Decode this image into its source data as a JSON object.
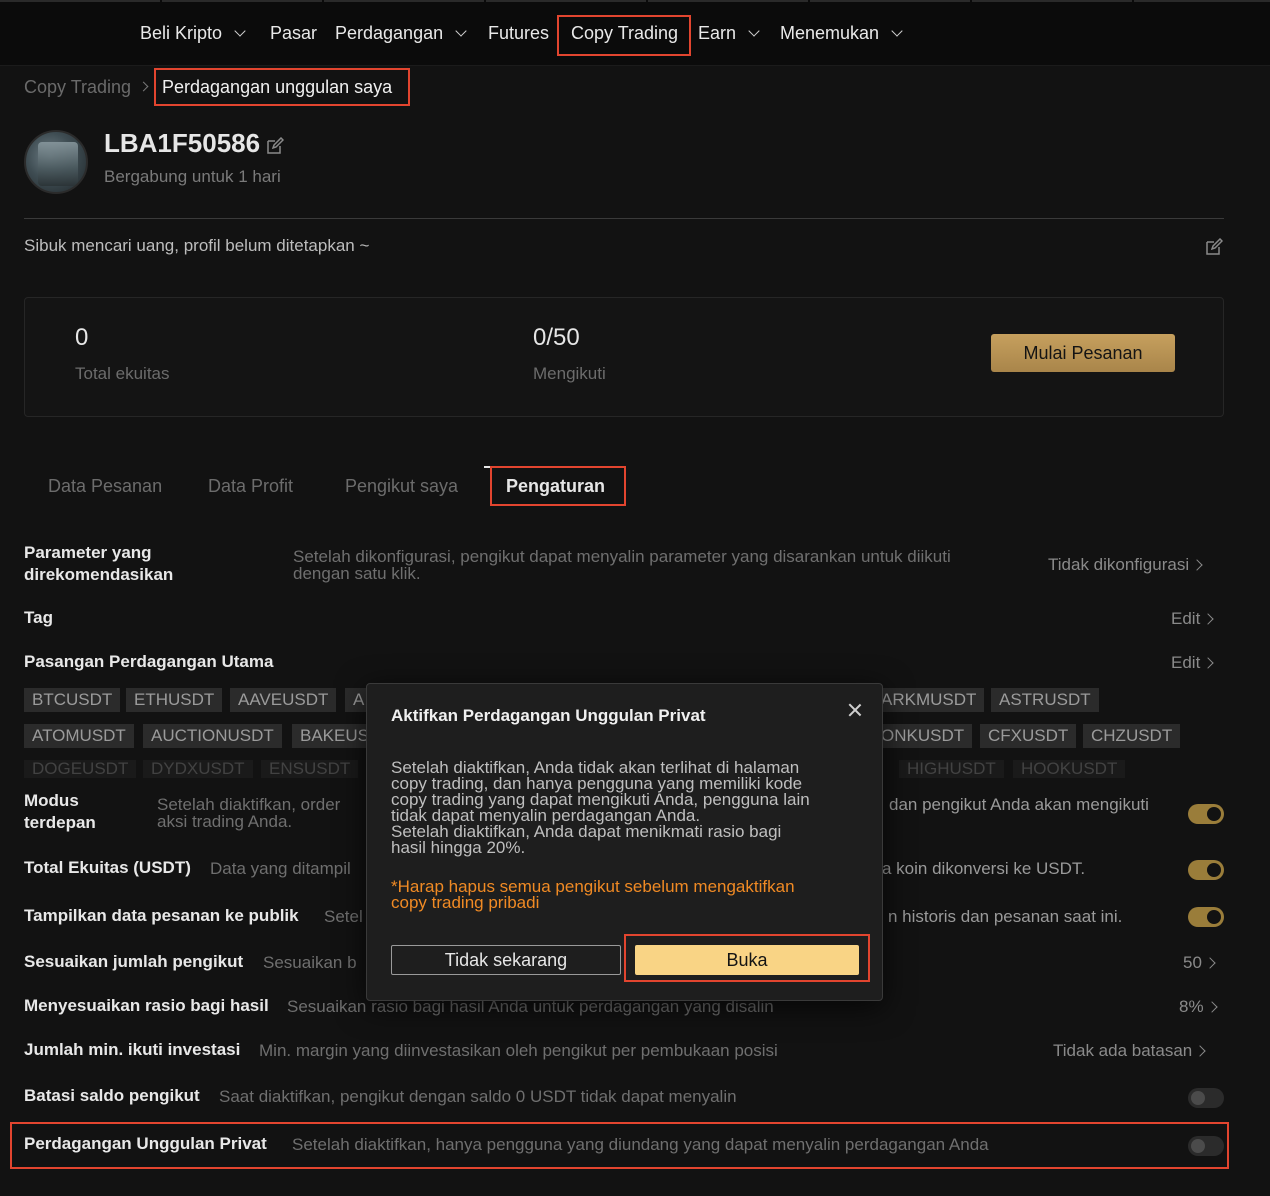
{
  "nav": {
    "items": [
      {
        "label": "Beli Kripto",
        "dropdown": true
      },
      {
        "label": "Pasar",
        "dropdown": false
      },
      {
        "label": "Perdagangan",
        "dropdown": true
      },
      {
        "label": "Futures",
        "dropdown": false
      },
      {
        "label": "Copy Trading",
        "dropdown": false
      },
      {
        "label": "Earn",
        "dropdown": true
      },
      {
        "label": "Menemukan",
        "dropdown": true
      }
    ]
  },
  "breadcrumb": {
    "parent": "Copy Trading",
    "current": "Perdagangan unggulan saya"
  },
  "profile": {
    "username": "LBA1F50586",
    "joined": "Bergabung untuk 1 hari",
    "bio": "Sibuk mencari uang, profil belum ditetapkan ~"
  },
  "stats": {
    "equity_value": "0",
    "equity_label": "Total ekuitas",
    "followers_value": "0/50",
    "followers_label": "Mengikuti",
    "start_button": "Mulai Pesanan"
  },
  "tabs": [
    "Data Pesanan",
    "Data Profit",
    "Pengikut saya",
    "Pengaturan"
  ],
  "settings": {
    "recommended": {
      "label_line1": "Parameter yang",
      "label_line2": "direkomendasikan",
      "desc_line1": "Setelah dikonfigurasi, pengikut dapat menyalin parameter yang disarankan untuk diikuti",
      "desc_line2": "dengan satu klik.",
      "value": "Tidak dikonfigurasi"
    },
    "tag": {
      "label": "Tag",
      "value": "Edit"
    },
    "main_pairs": {
      "label": "Pasangan Perdagangan Utama",
      "value": "Edit"
    },
    "pairs_row1": [
      "BTCUSDT",
      "ETHUSDT",
      "AAVEUSDT",
      "A",
      "ARKMUSDT",
      "ASTRUSDT"
    ],
    "pairs_row2": [
      "ATOMUSDT",
      "AUCTIONUSDT",
      "BAKEUS",
      "ONKUSDT",
      "CFXUSDT",
      "CHZUSDT"
    ],
    "pairs_row3": [
      "DOGEUSDT",
      "DYDXUSDT",
      "ENSUSDT",
      "HIGHUSDT",
      "HOOKUSDT"
    ],
    "lead_mode": {
      "label_line1": "Modus",
      "label_line2": "terdepan",
      "desc_left_line1": "Setelah diaktifkan, order",
      "desc_left_line2": "aksi trading Anda.",
      "desc_right": "dan pengikut Anda akan mengikuti",
      "enabled": true
    },
    "total_equity": {
      "label": "Total Ekuitas (USDT)",
      "desc_left": "Data yang ditampil",
      "desc_right": "a koin dikonversi ke USDT.",
      "enabled": true
    },
    "public_orders": {
      "label": "Tampilkan data pesanan ke publik",
      "desc_left": "Setel",
      "desc_right": "n historis dan pesanan saat ini.",
      "enabled": true
    },
    "follower_count": {
      "label": "Sesuaikan jumlah pengikut",
      "desc": "Sesuaikan b",
      "value": "50"
    },
    "profit_share": {
      "label": "Menyesuaikan rasio bagi hasil",
      "desc": "Sesuaikan rasio bagi hasil Anda untuk perdagangan yang disalin",
      "value": "8%"
    },
    "min_invest": {
      "label": "Jumlah min. ikuti investasi",
      "desc": "Min. margin yang diinvestasikan oleh pengikut per pembukaan posisi",
      "value": "Tidak ada batasan"
    },
    "limit_balance": {
      "label": "Batasi saldo pengikut",
      "desc": "Saat diaktifkan, pengikut dengan saldo 0 USDT tidak dapat menyalin",
      "enabled": false
    },
    "private_lead": {
      "label": "Perdagangan Unggulan Privat",
      "desc": "Setelah diaktifkan, hanya pengguna yang diundang yang dapat menyalin perdagangan Anda",
      "enabled": false
    }
  },
  "modal": {
    "title": "Aktifkan Perdagangan Unggulan Privat",
    "body_lines": [
      "Setelah diaktifkan, Anda tidak akan terlihat di halaman",
      "copy trading, dan hanya pengguna yang memiliki kode",
      "copy trading yang dapat mengikuti Anda, pengguna lain",
      "tidak dapat menyalin perdagangan Anda.",
      "Setelah diaktifkan, Anda dapat menikmati rasio bagi",
      "hasil hingga 20%."
    ],
    "warning_lines": [
      "*Harap hapus semua pengikut sebelum mengaktifkan",
      "copy trading pribadi"
    ],
    "cancel_button": "Tidak sekarang",
    "confirm_button": "Buka"
  },
  "colors": {
    "accent_gold": "#c6a05e",
    "confirm_yellow": "#f9d485",
    "warning_orange": "#f08a24",
    "highlight_red": "#e2452f"
  }
}
